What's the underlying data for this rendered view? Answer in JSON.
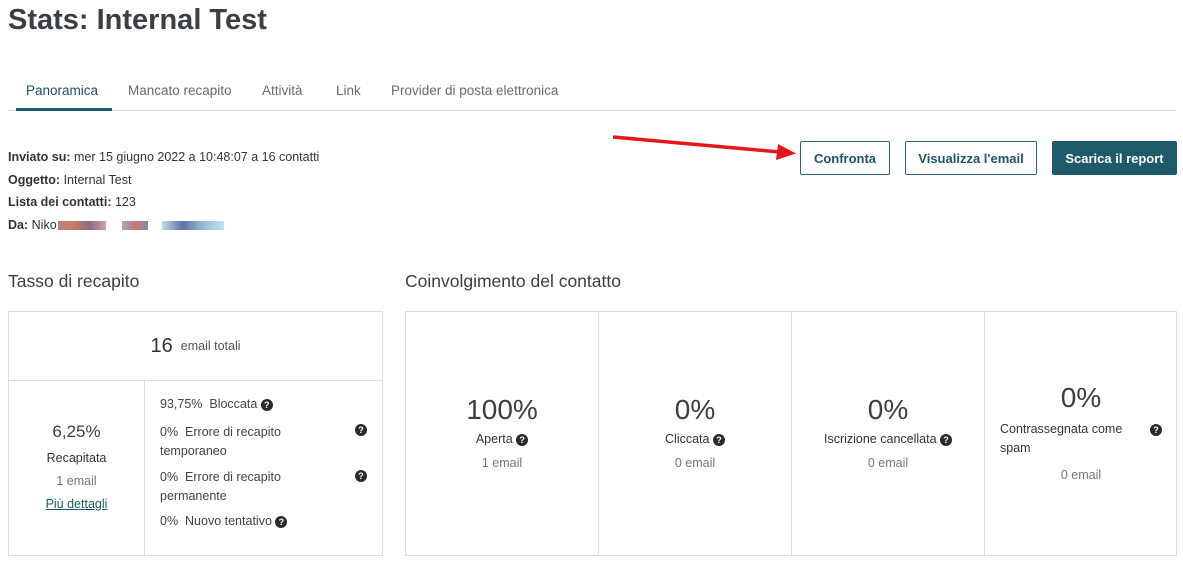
{
  "page": {
    "title": "Stats: Internal Test"
  },
  "tabs": [
    {
      "label": "Panoramica",
      "active": true
    },
    {
      "label": "Mancato recapito"
    },
    {
      "label": "Attività"
    },
    {
      "label": "Link"
    },
    {
      "label": "Provider di posta elettronica"
    }
  ],
  "meta": {
    "sent_label": "Inviato su:",
    "sent_value": "mer 15 giugno 2022 a 10:48:07 a 16 contatti",
    "subject_label": "Oggetto:",
    "subject_value": "Internal Test",
    "list_label": "Lista dei contatti:",
    "list_value": "123",
    "from_label": "Da:",
    "from_value": "Niko"
  },
  "actions": {
    "compare": "Confronta",
    "view_email": "Visualizza l'email",
    "download_report": "Scarica il report"
  },
  "delivery": {
    "section_title": "Tasso di recapito",
    "total_value": "16",
    "total_label": "email totali",
    "delivered_percent": "6,25%",
    "delivered_label": "Recapitata",
    "delivered_count": "1 email",
    "more_details": "Più dettagli",
    "breakdown": [
      {
        "percent": "93,75%",
        "label": "Bloccata"
      },
      {
        "percent": "0%",
        "label": "Errore di recapito temporaneo"
      },
      {
        "percent": "0%",
        "label": "Errore di recapito permanente"
      },
      {
        "percent": "0%",
        "label": "Nuovo tentativo"
      }
    ]
  },
  "engagement": {
    "section_title": "Coinvolgimento del contatto",
    "metrics": [
      {
        "percent": "100%",
        "label": "Aperta",
        "count": "1 email"
      },
      {
        "percent": "0%",
        "label": "Cliccata",
        "count": "0 email"
      },
      {
        "percent": "0%",
        "label": "Iscrizione cancellata",
        "count": "0 email"
      },
      {
        "percent": "0%",
        "label": "Contrassegnata come spam",
        "count": "0 email"
      }
    ]
  },
  "icons": {
    "help": "question-circle-icon",
    "arrow": "red-arrow-icon"
  },
  "colors": {
    "accent": "#1e5a6a",
    "arrow": "#e8141b"
  }
}
